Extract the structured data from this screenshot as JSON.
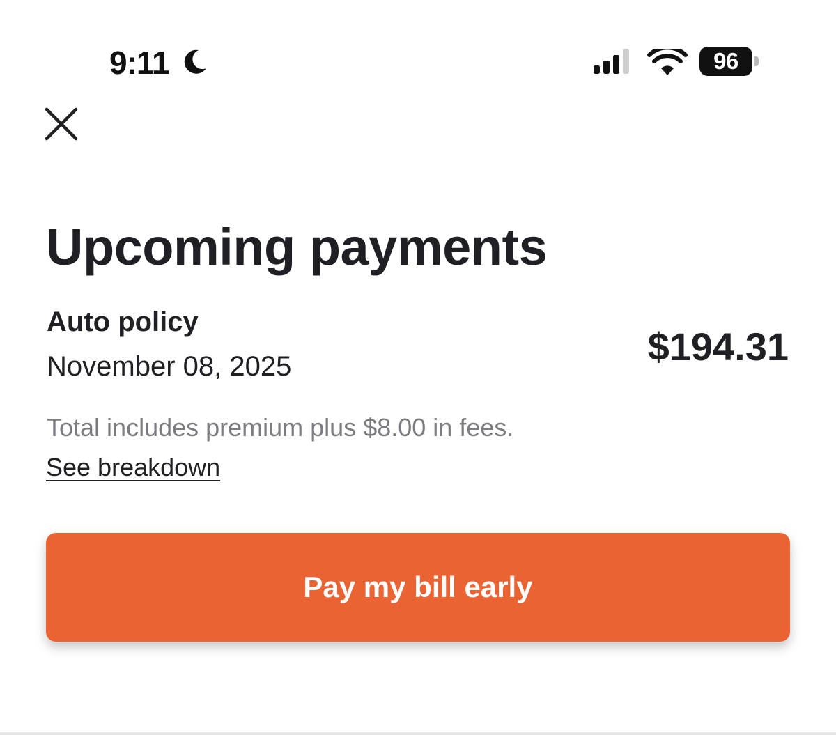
{
  "status_bar": {
    "time": "9:11",
    "battery_level": "96",
    "icons": [
      "moon-icon",
      "cellular-signal-icon",
      "wifi-icon",
      "battery-icon"
    ]
  },
  "header": {
    "close_icon": "close-icon"
  },
  "main": {
    "title": "Upcoming payments",
    "payment": {
      "policy": "Auto policy",
      "date": "November 08, 2025",
      "amount": "$194.31",
      "note": "Total includes premium plus $8.00 in fees.",
      "link": "See breakdown"
    },
    "pay_button_label": "Pay my bill early"
  },
  "colors": {
    "accent": "#ea6333",
    "text_primary": "#1f1f24",
    "text_secondary": "#7b7b80",
    "background": "#ffffff"
  }
}
